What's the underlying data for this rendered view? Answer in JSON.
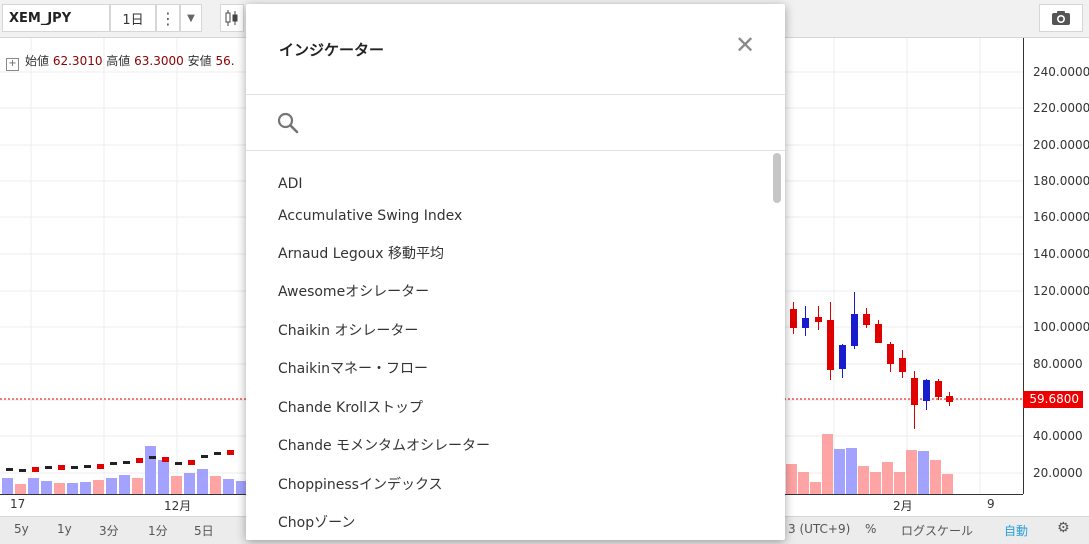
{
  "toolbar": {
    "symbol": "XEM_JPY",
    "interval": "1日",
    "more_icon": "vertical-dots-icon",
    "dropdown_icon": "caret-down-icon",
    "chart_type_icon": "candles-icon",
    "snapshot_icon": "camera-icon"
  },
  "legend": {
    "open_label": "始値",
    "open_value": "62.3010",
    "high_label": "高値",
    "high_value": "63.3000",
    "low_label": "安値",
    "low_value": "56."
  },
  "price_axis": {
    "labels": [
      "240.0000",
      "220.0000",
      "200.0000",
      "180.0000",
      "160.0000",
      "140.0000",
      "120.0000",
      "100.0000",
      "80.0000",
      "40.0000",
      "20.0000"
    ],
    "current_price": "59.6800"
  },
  "time_axis": {
    "labels": [
      "17",
      "12月",
      "2月",
      "9"
    ]
  },
  "bottom_bar": {
    "ranges": [
      "5y",
      "1y",
      "3分",
      "1分",
      "5日"
    ],
    "timezone": "3 (UTC+9)",
    "percent": "%",
    "log_scale": "ログスケール",
    "auto": "自動",
    "settings_icon": "gear-icon"
  },
  "modal": {
    "title": "インジケーター",
    "close_icon": "close-icon",
    "search_icon": "search-icon",
    "search_value": "",
    "search_placeholder": "",
    "items": [
      "ADI",
      "Accumulative Swing Index",
      "Arnaud Legoux 移動平均",
      "Awesomeオシレーター",
      "Chaikin オシレーター",
      "Chaikinマネー・フロー",
      "Chande Krollストップ",
      "Chande モメンタムオシレーター",
      "Choppinessインデックス",
      "Chopゾーン"
    ]
  },
  "colors": {
    "up": "#1a1acf",
    "down": "#e00000",
    "volume_up": "#9999ff",
    "volume_down": "#ff9a9a",
    "price_marker": "#ee0000",
    "auto_active": "#2a9fd8"
  }
}
